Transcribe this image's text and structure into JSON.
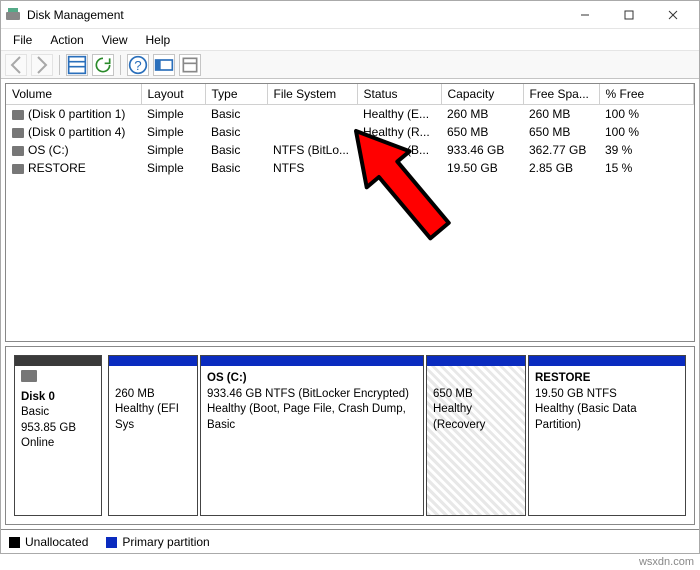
{
  "window": {
    "title": "Disk Management"
  },
  "menu": {
    "file": "File",
    "action": "Action",
    "view": "View",
    "help": "Help"
  },
  "columns": {
    "volume": "Volume",
    "layout": "Layout",
    "type": "Type",
    "filesystem": "File System",
    "status": "Status",
    "capacity": "Capacity",
    "freespace": "Free Spa...",
    "pctfree": "% Free"
  },
  "rows": [
    {
      "volume": "(Disk 0 partition 1)",
      "layout": "Simple",
      "type": "Basic",
      "fs": "",
      "status": "Healthy (E...",
      "capacity": "260 MB",
      "free": "260 MB",
      "pct": "100 %"
    },
    {
      "volume": "(Disk 0 partition 4)",
      "layout": "Simple",
      "type": "Basic",
      "fs": "",
      "status": "Healthy (R...",
      "capacity": "650 MB",
      "free": "650 MB",
      "pct": "100 %"
    },
    {
      "volume": "OS (C:)",
      "layout": "Simple",
      "type": "Basic",
      "fs": "NTFS (BitLo...",
      "status": "Healthy (B...",
      "capacity": "933.46 GB",
      "free": "362.77 GB",
      "pct": "39 %"
    },
    {
      "volume": "RESTORE",
      "layout": "Simple",
      "type": "Basic",
      "fs": "NTFS",
      "status": "",
      "capacity": "19.50 GB",
      "free": "2.85 GB",
      "pct": "15 %"
    }
  ],
  "disk": {
    "name": "Disk 0",
    "type": "Basic",
    "size": "953.85 GB",
    "state": "Online",
    "parts": [
      {
        "line1": "260 MB",
        "line2": "Healthy (EFI Sys"
      },
      {
        "title": "OS  (C:)",
        "line1": "933.46 GB NTFS (BitLocker Encrypted)",
        "line2": "Healthy (Boot, Page File, Crash Dump, Basic"
      },
      {
        "line1": "650 MB",
        "line2": "Healthy (Recovery"
      },
      {
        "title": "RESTORE",
        "line1": "19.50 GB NTFS",
        "line2": "Healthy (Basic Data Partition)"
      }
    ]
  },
  "legend": {
    "unallocated": "Unallocated",
    "primary": "Primary partition"
  },
  "footer": {
    "credit": "wsxdn.com"
  }
}
